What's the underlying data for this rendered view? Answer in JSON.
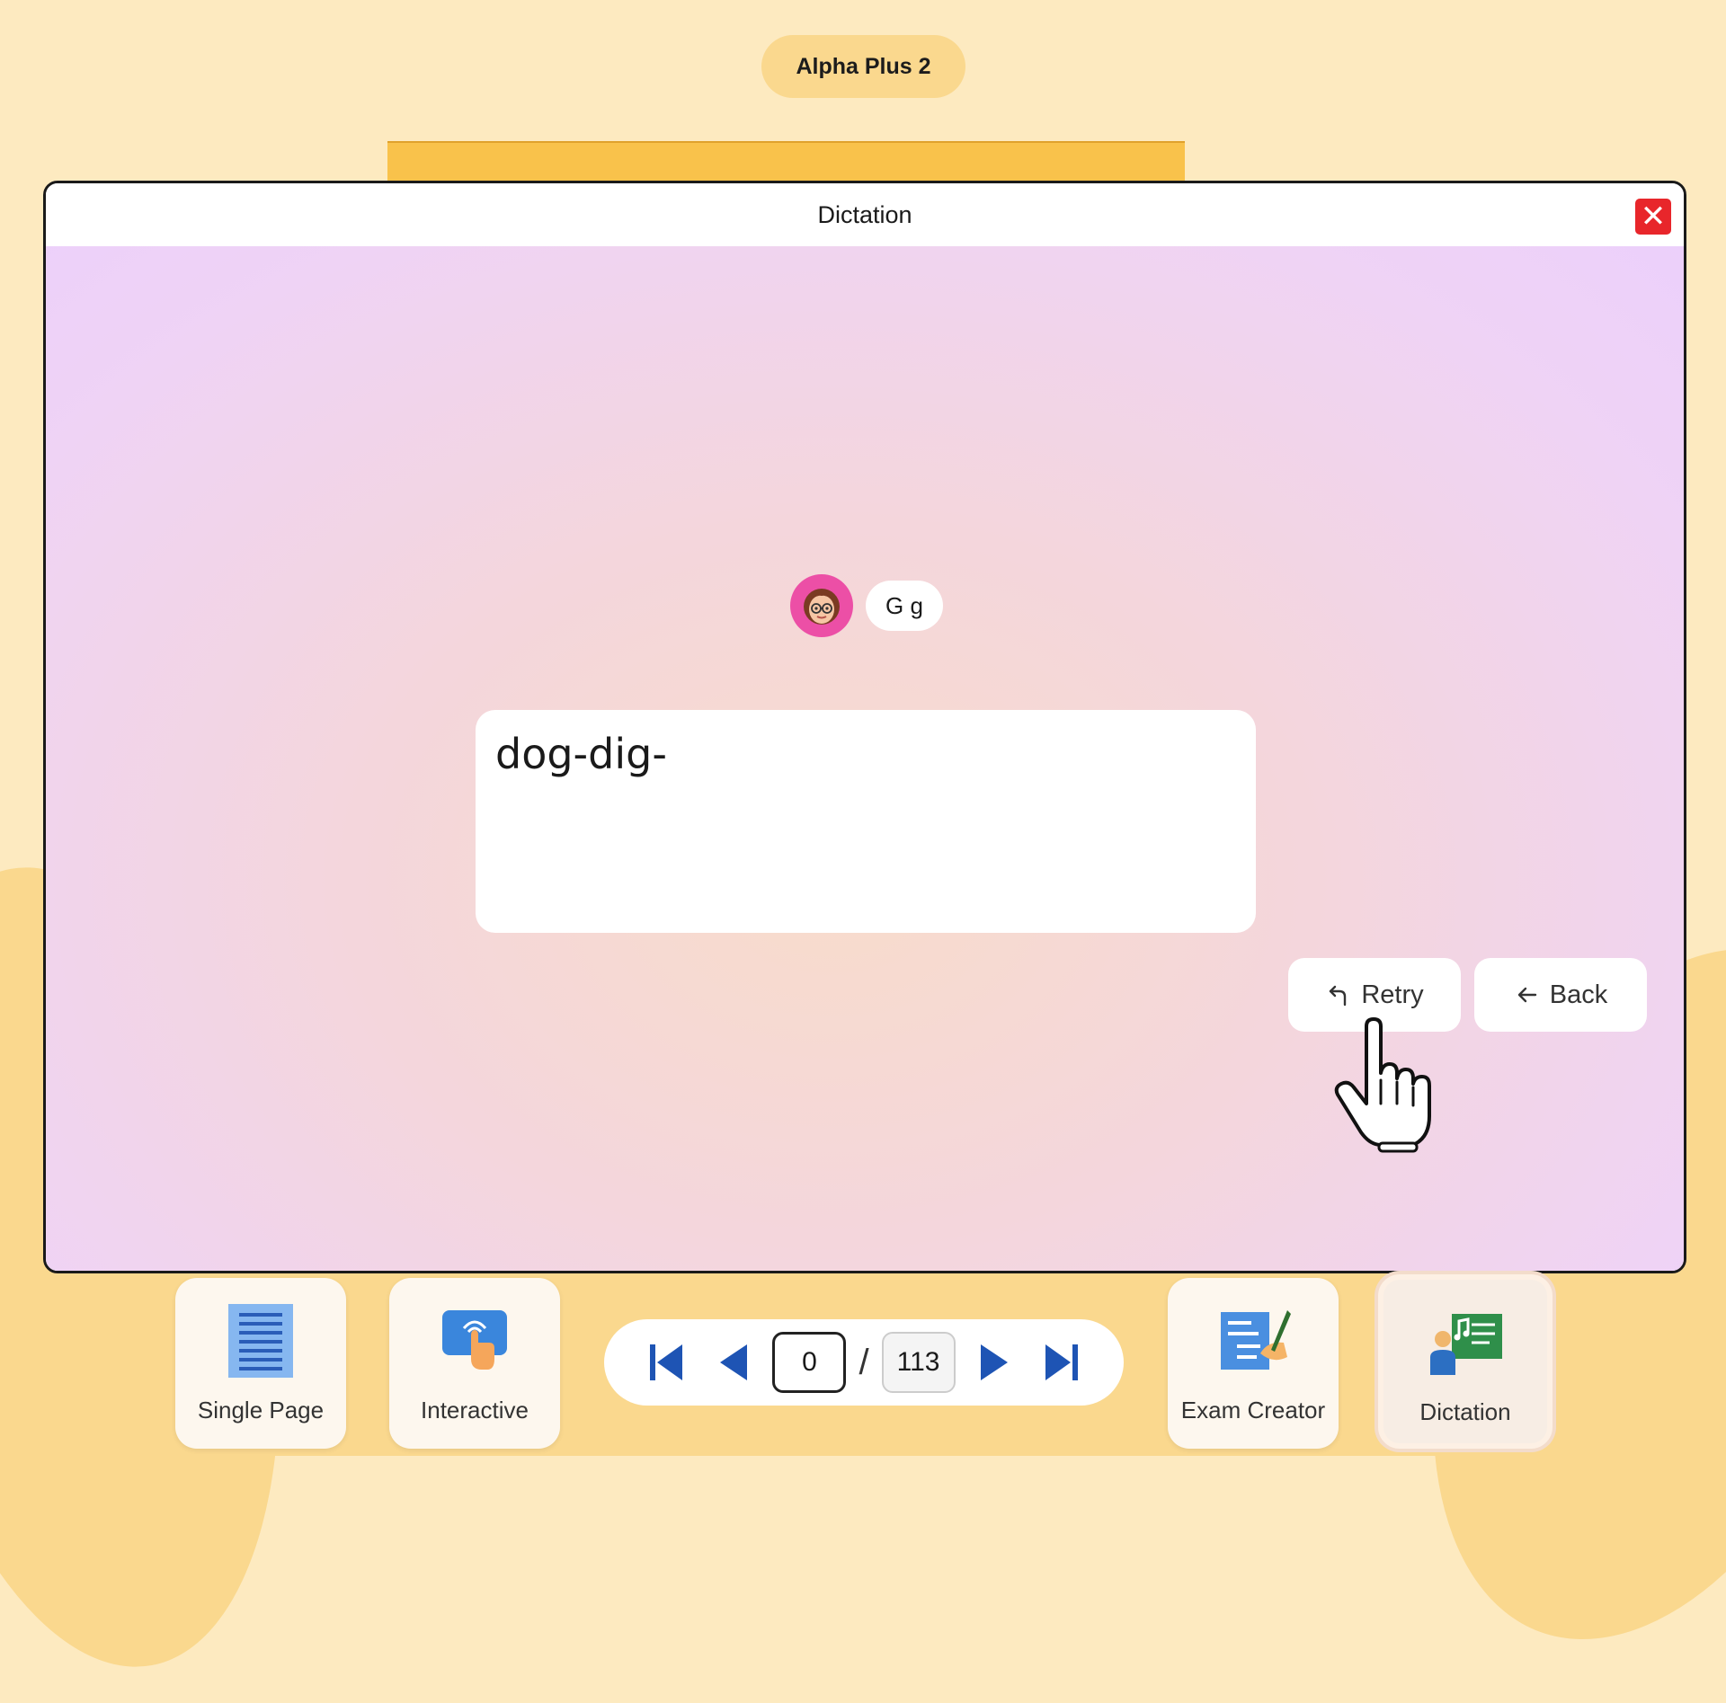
{
  "app": {
    "title": "Alpha Plus 2"
  },
  "modal": {
    "title": "Dictation",
    "close_label": "✕",
    "letter": "G g",
    "answer_text": "dog-dig-",
    "retry_label": "Retry",
    "back_label": "Back"
  },
  "toolbar": {
    "single_page_label": "Single Page",
    "interactive_label": "Interactive",
    "exam_creator_label": "Exam Creator",
    "dictation_label": "Dictation"
  },
  "pager": {
    "current_page": "0",
    "separator": "/",
    "total_pages": "113"
  },
  "colors": {
    "background": "#fdeac0",
    "accent_yellow": "#f9c24b",
    "close_red": "#e8262b",
    "pager_blue": "#1e54b4",
    "avatar_pink": "#ec4fa6"
  },
  "icons": {
    "close": "close-icon",
    "retry": "undo-icon",
    "back": "arrow-left-icon",
    "first": "first-page-icon",
    "prev": "previous-page-icon",
    "next": "next-page-icon",
    "last": "last-page-icon"
  }
}
